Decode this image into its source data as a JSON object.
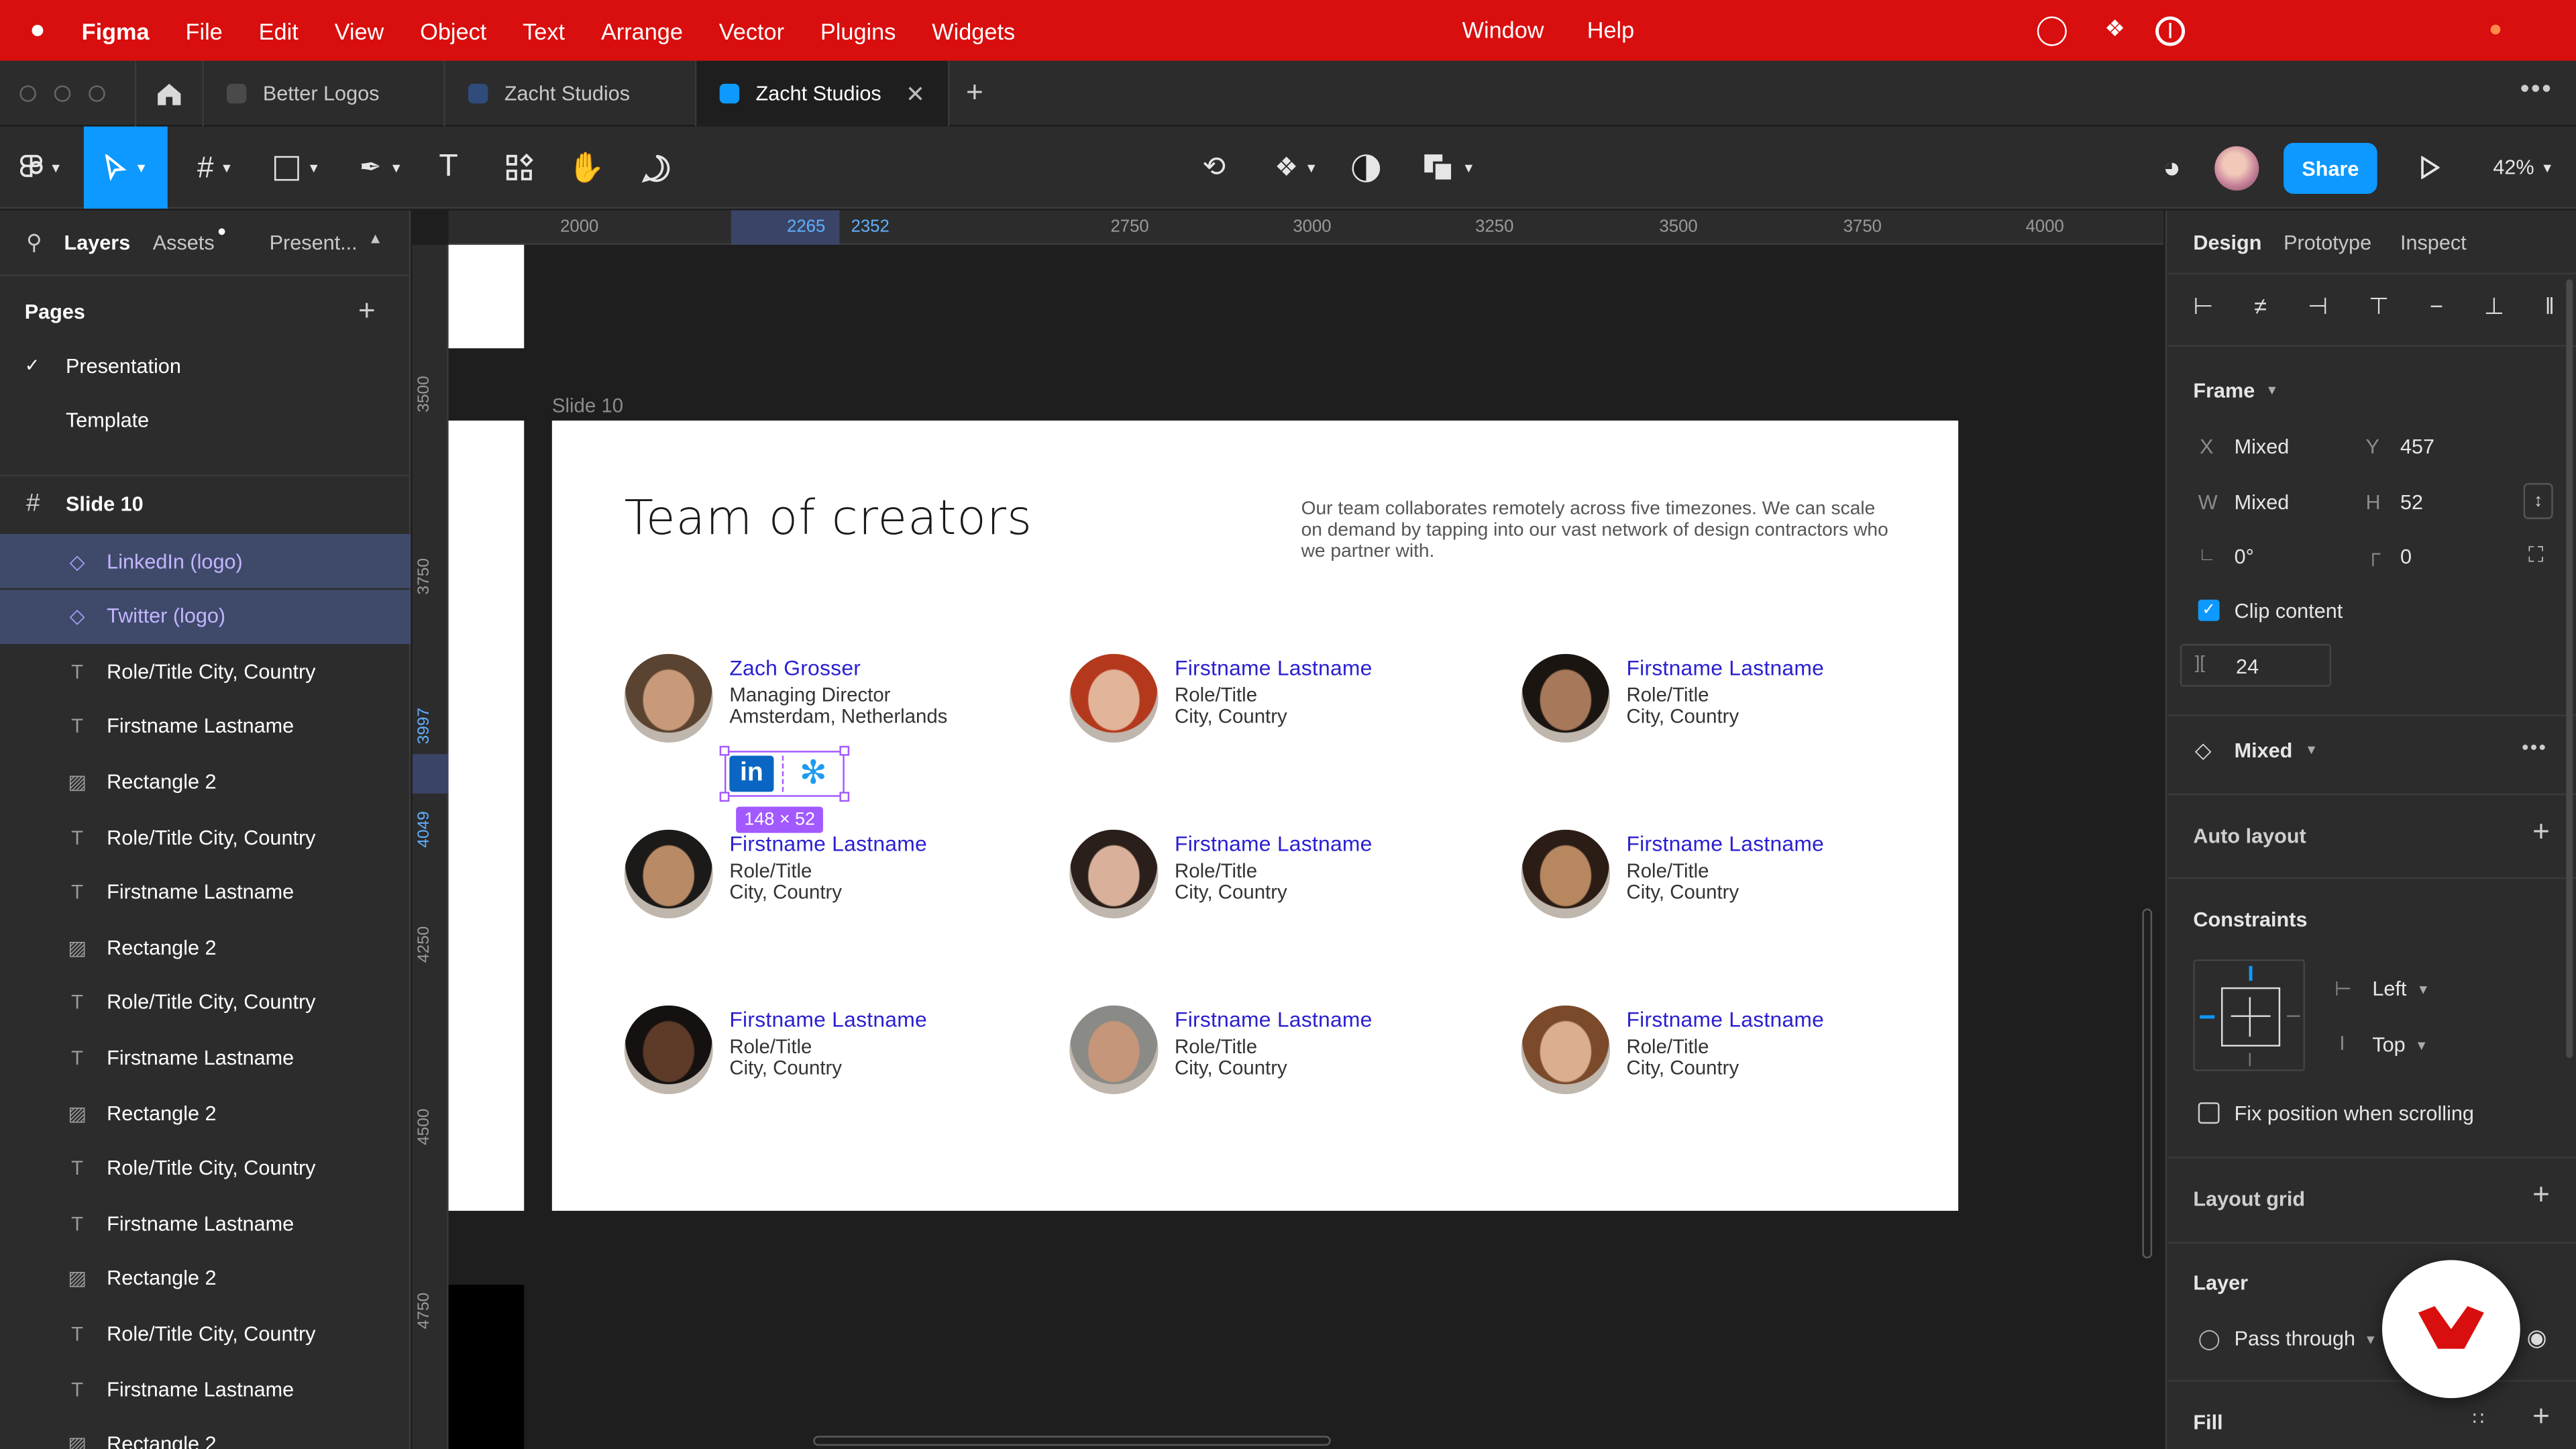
{
  "menubar": {
    "app": "Figma",
    "items": [
      "File",
      "Edit",
      "View",
      "Object",
      "Text",
      "Arrange",
      "Vector",
      "Plugins",
      "Widgets"
    ],
    "window": "Window",
    "help": "Help"
  },
  "tabs": [
    {
      "label": "Better Logos"
    },
    {
      "label": "Zacht Studios"
    },
    {
      "label": "Zacht Studios",
      "active": true
    }
  ],
  "toolbar": {
    "share": "Share",
    "zoom": "42%"
  },
  "left_panel": {
    "tab_layers": "Layers",
    "tab_assets": "Assets",
    "tab_present": "Present...",
    "pages_title": "Pages",
    "pages": [
      "Presentation",
      "Template"
    ],
    "frame": "Slide 10",
    "layers": [
      {
        "label": "LinkedIn (logo)",
        "type": "component",
        "selected": true
      },
      {
        "label": "Twitter (logo)",
        "type": "component",
        "selected": true
      },
      {
        "label": "Role/Title City, Country",
        "type": "text"
      },
      {
        "label": "Firstname Lastname",
        "type": "text"
      },
      {
        "label": "Rectangle 2",
        "type": "image"
      },
      {
        "label": "Role/Title City, Country",
        "type": "text"
      },
      {
        "label": "Firstname Lastname",
        "type": "text"
      },
      {
        "label": "Rectangle 2",
        "type": "image"
      },
      {
        "label": "Role/Title City, Country",
        "type": "text"
      },
      {
        "label": "Firstname Lastname",
        "type": "text"
      },
      {
        "label": "Rectangle 2",
        "type": "image"
      },
      {
        "label": "Role/Title City, Country",
        "type": "text"
      },
      {
        "label": "Firstname Lastname",
        "type": "text"
      },
      {
        "label": "Rectangle 2",
        "type": "image"
      },
      {
        "label": "Role/Title City, Country",
        "type": "text"
      },
      {
        "label": "Firstname Lastname",
        "type": "text"
      },
      {
        "label": "Rectangle 2",
        "type": "image"
      }
    ]
  },
  "rulers": {
    "h_ticks": [
      "2000",
      "2265",
      "2352",
      "2750",
      "3000",
      "3250",
      "3500",
      "3750",
      "4000"
    ],
    "v_ticks": [
      "3500",
      "3750",
      "3997",
      "4049",
      "4250",
      "4500",
      "4750"
    ]
  },
  "slide": {
    "frame_label": "Slide 10",
    "title": "Team of creators",
    "description": "Our team collaborates remotely across five timezones. We can scale on demand by tapping into our vast network of design contractors who we partner with.",
    "selection_size": "148 × 52",
    "people": [
      {
        "name": "Zach Grosser",
        "role": "Managing Director",
        "city": "Amsterdam, Netherlands",
        "skin": "#c89a7a",
        "hair": "#5a4330"
      },
      {
        "name": "Firstname Lastname",
        "role": "Role/Title",
        "city": "City, Country",
        "skin": "#e2b49a",
        "hair": "#b4391c"
      },
      {
        "name": "Firstname Lastname",
        "role": "Role/Title",
        "city": "City, Country",
        "skin": "#a7785a",
        "hair": "#1b1512"
      },
      {
        "name": "Firstname Lastname",
        "role": "Role/Title",
        "city": "City, Country",
        "skin": "#b98a66",
        "hair": "#1c1a18"
      },
      {
        "name": "Firstname Lastname",
        "role": "Role/Title",
        "city": "City, Country",
        "skin": "#d9b19a",
        "hair": "#2a1f1b"
      },
      {
        "name": "Firstname Lastname",
        "role": "Role/Title",
        "city": "City, Country",
        "skin": "#b7875f",
        "hair": "#2b1d15"
      },
      {
        "name": "Firstname Lastname",
        "role": "Role/Title",
        "city": "City, Country",
        "skin": "#5d3b28",
        "hair": "#151110"
      },
      {
        "name": "Firstname Lastname",
        "role": "Role/Title",
        "city": "City, Country",
        "skin": "#c6967a",
        "hair": "#8a8a86"
      },
      {
        "name": "Firstname Lastname",
        "role": "Role/Title",
        "city": "City, Country",
        "skin": "#dcae90",
        "hair": "#7a4a2a"
      }
    ]
  },
  "right_panel": {
    "tabs": [
      "Design",
      "Prototype",
      "Inspect"
    ],
    "frame_title": "Frame",
    "x_label": "X",
    "x_value": "Mixed",
    "y_label": "Y",
    "y_value": "457",
    "w_label": "W",
    "w_value": "Mixed",
    "h_label": "H",
    "h_value": "52",
    "rotation": "0°",
    "radius": "0",
    "clip_content": "Clip content",
    "spacing": "24",
    "component": "Mixed",
    "auto_layout": "Auto layout",
    "constraints": "Constraints",
    "constraint_h": "Left",
    "constraint_v": "Top",
    "fix_position": "Fix position when scrolling",
    "layout_grid": "Layout grid",
    "layer": "Layer",
    "blend": "Pass through",
    "fill": "Fill"
  },
  "colors": {
    "menubar": "#d90e0e",
    "accent": "#0d99ff",
    "selection": "#a259ff",
    "name_text": "#2a1fd0"
  }
}
